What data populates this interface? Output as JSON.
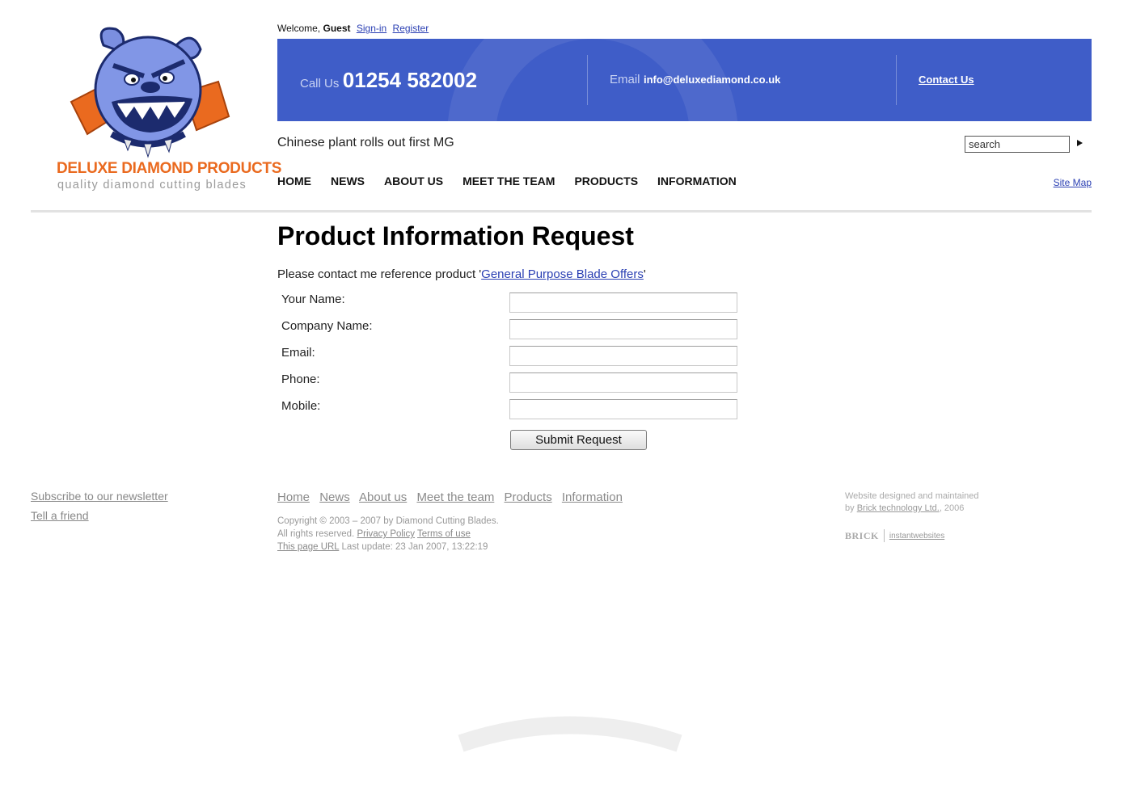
{
  "logo": {
    "name": "DELUXE DIAMOND PRODUCTS",
    "tagline": "quality diamond cutting blades"
  },
  "welcome": {
    "prefix": "Welcome,",
    "user": "Guest",
    "signin_label": "Sign-in",
    "register_label": "Register"
  },
  "banner": {
    "call_label": "Call Us",
    "phone": "01254 582002",
    "email_label": "Email",
    "email": "info@deluxediamond.co.uk",
    "contact_label": "Contact Us"
  },
  "news_headline": "Chinese plant rolls out first MG",
  "search": {
    "value": "search"
  },
  "nav": {
    "items": [
      "HOME",
      "NEWS",
      "ABOUT US",
      "MEET THE TEAM",
      "PRODUCTS",
      "INFORMATION"
    ],
    "sitemap_label": "Site Map"
  },
  "main": {
    "title": "Product Information Request",
    "intro_prefix": "Please contact me reference product '",
    "product_link": "General Purpose Blade Offers",
    "intro_suffix": "'"
  },
  "form": {
    "fields": [
      {
        "label": "Your Name:",
        "value": ""
      },
      {
        "label": "Company Name:",
        "value": ""
      },
      {
        "label": "Email:",
        "value": ""
      },
      {
        "label": "Phone:",
        "value": ""
      },
      {
        "label": "Mobile:",
        "value": ""
      }
    ],
    "submit_label": "Submit Request"
  },
  "footer": {
    "left_links": [
      "Subscribe to our newsletter",
      "Tell a friend"
    ],
    "nav_links": [
      "Home",
      "News",
      "About us",
      "Meet the team",
      "Products",
      "Information"
    ],
    "copyright": "Copyright © 2003 – 2007 by Diamond Cutting Blades.",
    "rights": "All rights reserved.",
    "privacy_label": "Privacy Policy",
    "terms_label": "Terms of use",
    "page_url_label": "This page URL",
    "last_update": "Last update: 23 Jan 2007, 13:22:19",
    "credit_line1": "Website designed and maintained",
    "credit_by": "by",
    "credit_company": "Brick technology Ltd.",
    "credit_year": ", 2006",
    "credit_brand": "BRICK",
    "credit_product": "instantwebsites"
  },
  "colors": {
    "banner_blue": "#3f5dc8",
    "logo_orange": "#ea6a1f",
    "link_blue": "#2a3fb3"
  },
  "icons": {
    "logo_image": "bulldog-icon",
    "search_submit": "play-arrow-icon"
  }
}
